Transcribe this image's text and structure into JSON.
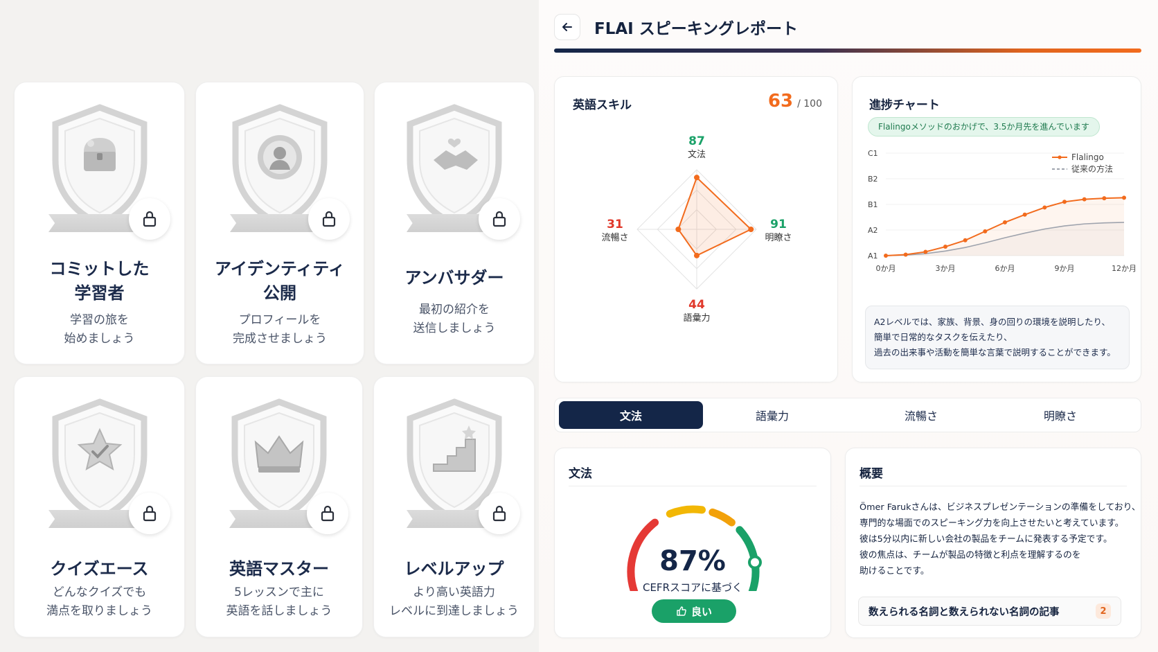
{
  "badges": [
    {
      "title1": "コミットした",
      "title2": "学習者",
      "desc1": "学習の旅を",
      "desc2": "始めましょう",
      "icon": "treasure-chest-icon"
    },
    {
      "title1": "アイデンティティ",
      "title2": "公開",
      "desc1": "プロフィールを",
      "desc2": "完成させましょう",
      "icon": "profile-medal-icon"
    },
    {
      "title1": "アンバサダー",
      "title2": "",
      "desc1": "最初の紹介を",
      "desc2": "送信しましょう",
      "icon": "handshake-icon"
    },
    {
      "title1": "クイズエース",
      "title2": "",
      "desc1": "どんなクイズでも",
      "desc2": "満点を取りましょう",
      "icon": "star-check-icon"
    },
    {
      "title1": "英語マスター",
      "title2": "",
      "desc1": "5レッスンで主に",
      "desc2": "英語を話しましょう",
      "icon": "crown-icon"
    },
    {
      "title1": "レベルアップ",
      "title2": "",
      "desc1": "より高い英語力",
      "desc2": "レベルに到達しましょう",
      "icon": "stairs-star-icon"
    }
  ],
  "header": {
    "title": "FLAI スピーキングレポート",
    "back_icon": "arrow-left-icon"
  },
  "skills": {
    "title": "英語スキル",
    "score": "63",
    "max": "/ 100",
    "axes": [
      {
        "value": "87",
        "label": "文法",
        "color": "#1aa168",
        "v": 87
      },
      {
        "value": "91",
        "label": "明瞭さ",
        "color": "#1aa168",
        "v": 91
      },
      {
        "value": "44",
        "label": "語彙力",
        "color": "#e0392b",
        "v": 44
      },
      {
        "value": "31",
        "label": "流暢さ",
        "color": "#e0392b",
        "v": 31
      }
    ]
  },
  "progress": {
    "title": "進捗チャート",
    "badge": "Flalingoメソッドのおかげで、3.5か月先を進んでいます",
    "description": [
      "A2レベルでは、家族、背景、身の回りの環境を説明したり、",
      "簡単で日常的なタスクを伝えたり、",
      "過去の出来事や活動を簡単な言葉で説明することができます。"
    ]
  },
  "chart_data": {
    "type": "line",
    "x": [
      0,
      1,
      2,
      3,
      4,
      5,
      6,
      7,
      8,
      9,
      10,
      11,
      12
    ],
    "xticks": [
      "0か月",
      "3か月",
      "6か月",
      "9か月",
      "12か月"
    ],
    "xtick_values": [
      0,
      3,
      6,
      9,
      12
    ],
    "yticks": [
      "A1",
      "A2",
      "B1",
      "B2",
      "C1"
    ],
    "ylim": [
      0,
      4
    ],
    "series": [
      {
        "name": "Flalingo",
        "color": "#f26b1d",
        "values": [
          0.0,
          0.04,
          0.15,
          0.35,
          0.6,
          0.95,
          1.3,
          1.6,
          1.88,
          2.1,
          2.2,
          2.24,
          2.26
        ]
      },
      {
        "name": "従来の方法",
        "color": "#9ea3ad",
        "values": [
          0.0,
          0.02,
          0.08,
          0.18,
          0.32,
          0.5,
          0.7,
          0.88,
          1.04,
          1.16,
          1.24,
          1.28,
          1.3
        ]
      }
    ],
    "legend": "top-right",
    "grid": true
  },
  "tabs": [
    "文法",
    "語彙力",
    "流暢さ",
    "明瞭さ"
  ],
  "grammar": {
    "title": "文法",
    "percent": "87%",
    "basis": "CEFRスコアに基づく",
    "rating": "良い",
    "gauge_value": 0.87
  },
  "summary": {
    "title": "概要",
    "lines": [
      "Ömer Farukさんは、ビジネスプレゼンテーションの準備をしており、",
      "専門的な場面でのスピーキング力を向上させたいと考えています。",
      "彼は5分以内に新しい会社の製品をチームに発表する予定です。",
      "彼の焦点は、チームが製品の特徴と利点を理解するのを",
      "助けることです。"
    ],
    "item_label": "数えられる名詞と数えられない名詞の記事",
    "item_count": "2"
  }
}
